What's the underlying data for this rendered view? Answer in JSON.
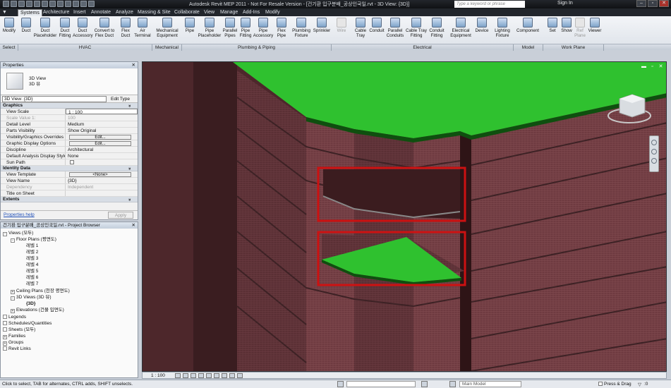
{
  "title_bar": {
    "app_title": "Autodesk Revit MEP 2011 - Not For Resale Version - [건기환 입구분배_공상인국일.rvt - 3D View: {3D}]",
    "search_placeholder": "Type a keyword or phrase",
    "sign_in": "Sign In",
    "window_controls": [
      "minimize-icon",
      "restore-icon",
      "close-icon"
    ]
  },
  "tabs": [
    "Systems",
    "Architecture",
    "Insert",
    "Annotate",
    "Analyze",
    "Massing & Site",
    "Collaborate",
    "View",
    "Manage",
    "Add-Ins",
    "Modify"
  ],
  "active_tab": "Systems",
  "ribbon": {
    "buttons": [
      {
        "label": "Modify",
        "icon": "cursor-icon"
      },
      {
        "label": "Duct",
        "icon": "duct-icon"
      },
      {
        "label": "Duct Placeholder",
        "icon": "duct-placeholder-icon"
      },
      {
        "label": "Duct Fitting",
        "icon": "duct-fitting-icon"
      },
      {
        "label": "Duct Accessory",
        "icon": "duct-accessory-icon"
      },
      {
        "label": "Convert to Flex Duct",
        "icon": "convert-flex-icon"
      },
      {
        "label": "Flex Duct",
        "icon": "flex-duct-icon"
      },
      {
        "label": "Air Terminal",
        "icon": "air-terminal-icon"
      },
      {
        "label": "Mechanical Equipment",
        "icon": "mechanical-equipment-icon"
      },
      {
        "label": "Pipe",
        "icon": "pipe-icon"
      },
      {
        "label": "Pipe Placeholder",
        "icon": "pipe-placeholder-icon"
      },
      {
        "label": "Parallel Pipes",
        "icon": "parallel-pipes-icon"
      },
      {
        "label": "Pipe Fitting",
        "icon": "pipe-fitting-icon"
      },
      {
        "label": "Pipe Accessory",
        "icon": "pipe-accessory-icon"
      },
      {
        "label": "Flex Pipe",
        "icon": "flex-pipe-icon"
      },
      {
        "label": "Plumbing Fixture",
        "icon": "plumbing-fixture-icon"
      },
      {
        "label": "Sprinkler",
        "icon": "sprinkler-icon"
      },
      {
        "label": "Wire",
        "icon": "wire-icon",
        "disabled": true
      },
      {
        "label": "Cable Tray",
        "icon": "cable-tray-icon"
      },
      {
        "label": "Conduit",
        "icon": "conduit-icon"
      },
      {
        "label": "Parallel Conduits",
        "icon": "parallel-conduits-icon"
      },
      {
        "label": "Cable Tray Fitting",
        "icon": "cable-tray-fitting-icon"
      },
      {
        "label": "Conduit Fitting",
        "icon": "conduit-fitting-icon"
      },
      {
        "label": "Electrical Equipment",
        "icon": "electrical-equipment-icon"
      },
      {
        "label": "Device",
        "icon": "device-icon"
      },
      {
        "label": "Lighting Fixture",
        "icon": "lighting-fixture-icon"
      },
      {
        "label": "Component",
        "icon": "component-icon"
      },
      {
        "label": "Set",
        "icon": "set-workplane-icon"
      },
      {
        "label": "Show",
        "icon": "show-workplane-icon"
      },
      {
        "label": "Ref Plane",
        "icon": "ref-plane-icon",
        "disabled": true
      },
      {
        "label": "Viewer",
        "icon": "viewer-icon"
      }
    ],
    "panels": [
      "Select",
      "HVAC",
      "Mechanical",
      "Plumbing & Piping",
      "Electrical",
      "Model",
      "Work Plane"
    ]
  },
  "properties": {
    "header": "Properties",
    "type_name_line1": "3D View",
    "type_name_line2": "3D 뷰",
    "view_selector": "3D View: {3D}",
    "edit_type": "Edit Type",
    "groups": {
      "graphics": "Graphics",
      "identity": "Identity Data",
      "extents": "Extents"
    },
    "rows": {
      "view_scale": {
        "k": "View Scale",
        "v": "1 : 100"
      },
      "scale_value": {
        "k": "Scale Value    1:",
        "v": "100"
      },
      "detail_level": {
        "k": "Detail Level",
        "v": "Medium"
      },
      "parts_visibility": {
        "k": "Parts Visibility",
        "v": "Show Original"
      },
      "vg_overrides": {
        "k": "Visibility/Graphics Overrides",
        "v": "Edit..."
      },
      "graphic_display": {
        "k": "Graphic Display Options",
        "v": "Edit..."
      },
      "discipline": {
        "k": "Discipline",
        "v": "Architectural"
      },
      "analysis_style": {
        "k": "Default Analysis Display Style",
        "v": "None"
      },
      "sun_path": {
        "k": "Sun Path",
        "v": ""
      },
      "view_template": {
        "k": "View Template",
        "v": "<None>"
      },
      "view_name": {
        "k": "View Name",
        "v": "{3D}"
      },
      "dependency": {
        "k": "Dependency",
        "v": "Independent"
      },
      "title_on_sheet": {
        "k": "Title on Sheet",
        "v": ""
      }
    },
    "help_link": "Properties help",
    "apply": "Apply"
  },
  "browser": {
    "header": "건기환 입구분배_공상인국일.rvt - Project Browser",
    "views": "Views (모두)",
    "floor_plans": "Floor Plans (평면도)",
    "levels": [
      "레벨 1",
      "레벨 2",
      "레벨 3",
      "레벨 4",
      "레벨 5",
      "레벨 6",
      "레벨 7"
    ],
    "ceiling_plans": "Ceiling Plans (천장 평면도)",
    "views_3d": "3D Views (3D 뷰)",
    "view_3d_item": "{3D}",
    "elevations": "Elevations (건물 입면도)",
    "legends": "Legends",
    "schedules": "Schedules/Quantities",
    "sheets": "Sheets (모두)",
    "families": "Families",
    "groups": "Groups",
    "revit_links": "Revit Links"
  },
  "viewport": {
    "viewcube_label": "ViewCube",
    "highlight_color": "#cc1111",
    "roof_color": "#2fc12f",
    "wall_color": "#6b3a3e"
  },
  "view_control": {
    "scale": "1 : 100"
  },
  "status": {
    "text": "Click to select, TAB for alternates, CTRL adds, SHIFT unselects.",
    "workset": "",
    "model": "Main Model",
    "press_drag": "Press & Drag",
    "filter_count": ":0"
  }
}
